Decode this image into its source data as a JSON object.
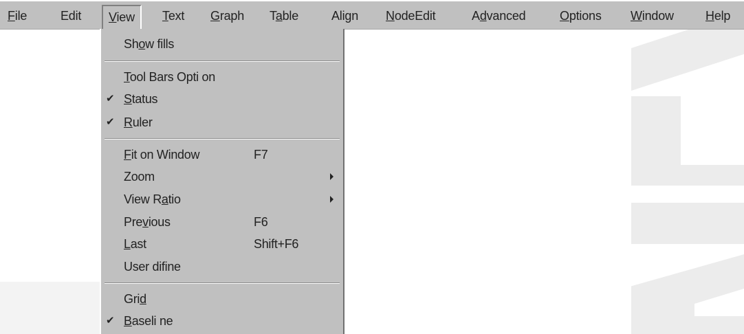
{
  "menubar": {
    "items": [
      {
        "pre": "",
        "key": "F",
        "post": "ile"
      },
      {
        "pre": "",
        "key": "",
        "post": "Edit"
      },
      {
        "pre": "",
        "key": "V",
        "post": "iew"
      },
      {
        "pre": "",
        "key": "T",
        "post": "ext"
      },
      {
        "pre": "",
        "key": "G",
        "post": "raph"
      },
      {
        "pre": "T",
        "key": "a",
        "post": "ble"
      },
      {
        "pre": "Al",
        "key": "",
        "post": "ign"
      },
      {
        "pre": "",
        "key": "N",
        "post": "odeEdit"
      },
      {
        "pre": "A",
        "key": "d",
        "post": "vanced"
      },
      {
        "pre": "",
        "key": "O",
        "post": "ptions"
      },
      {
        "pre": "",
        "key": "W",
        "post": "indow"
      },
      {
        "pre": "",
        "key": "H",
        "post": "elp"
      }
    ],
    "open_index": 2
  },
  "view_menu": {
    "show_fills": {
      "pre": "Sh",
      "key": "o",
      "post": "w fills"
    },
    "tool_bars_option": {
      "pre": "",
      "key": "T",
      "post": "ool Bars Opti on"
    },
    "status": {
      "pre": "",
      "key": "S",
      "post": "tatus",
      "checked": true
    },
    "ruler": {
      "pre": "",
      "key": "R",
      "post": "uler",
      "checked": true
    },
    "fit_on_window": {
      "pre": "",
      "key": "F",
      "post": "it on Window",
      "shortcut": "F7"
    },
    "zoom": {
      "pre": "",
      "key": "",
      "post": "Zoom",
      "submenu": true
    },
    "view_ratio": {
      "pre": "View R",
      "key": "a",
      "post": "tio",
      "submenu": true
    },
    "previous": {
      "pre": "Pre",
      "key": "v",
      "post": "ious",
      "shortcut": "F6"
    },
    "last": {
      "pre": "",
      "key": "L",
      "post": "ast",
      "shortcut": "Shift+F6"
    },
    "user_define": {
      "pre": "",
      "key": "",
      "post": "User difine"
    },
    "grid": {
      "pre": "Gri",
      "key": "d",
      "post": ""
    },
    "baseline": {
      "pre": "",
      "key": "B",
      "post": "aseli ne",
      "checked": true
    },
    "check_glyph": "✔"
  },
  "colors": {
    "menu_bg": "#c0c0c0",
    "text": "#222222",
    "watermark": "#ececec"
  }
}
